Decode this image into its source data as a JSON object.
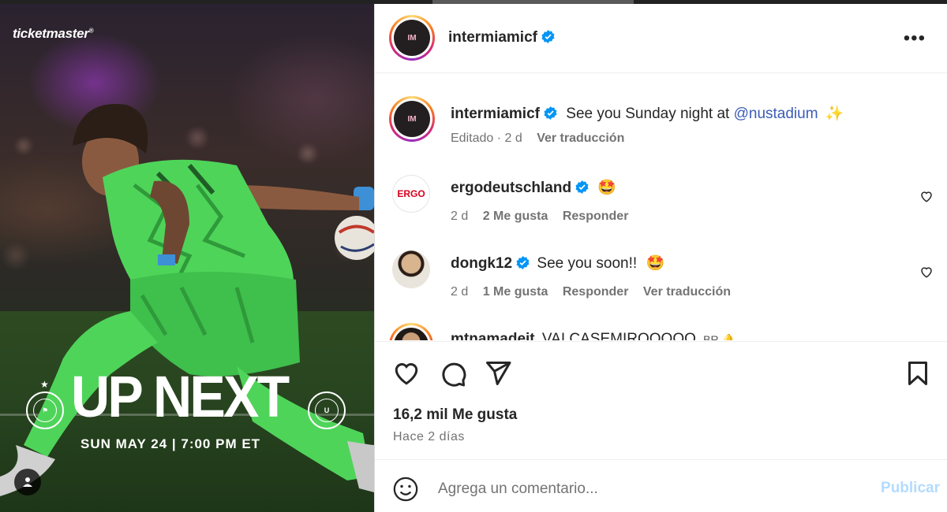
{
  "media": {
    "brand": "ticketmaster",
    "headline": "UP NEXT",
    "match_date": "SUN MAY 24 | 7:00 PM ET"
  },
  "header": {
    "username": "intermiamicf",
    "more_label": "•••"
  },
  "caption": {
    "username": "intermiamicf",
    "text": "See you Sunday night at",
    "mention": "@nustadium",
    "emoji": "✨",
    "edited": "Editado · 2 d",
    "translate": "Ver traducción"
  },
  "comments": [
    {
      "username": "ergodeutschland",
      "text": "",
      "emoji": "🤩",
      "time": "2 d",
      "likes": "2 Me gusta",
      "reply": "Responder",
      "translate": ""
    },
    {
      "username": "dongk12",
      "text": "See you soon!!",
      "emoji": "🤩",
      "time": "2 d",
      "likes": "1 Me gusta",
      "reply": "Responder",
      "translate": "Ver traducción"
    },
    {
      "username": "mtnamadeit",
      "text": "VAI CASEMIROOOOO",
      "emoji": "BR 🔔",
      "time": "",
      "likes": "",
      "reply": "",
      "translate": ""
    }
  ],
  "actions": {
    "likes": "16,2 mil Me gusta",
    "posted": "Hace 2 días"
  },
  "composer": {
    "placeholder": "Agrega un comentario...",
    "publish_label": "Publicar"
  },
  "colors": {
    "verified": "#0095f6",
    "mention": "#3b5bb5",
    "publish_disabled": "#b3dbff",
    "jersey_green": "#4fd45a"
  }
}
